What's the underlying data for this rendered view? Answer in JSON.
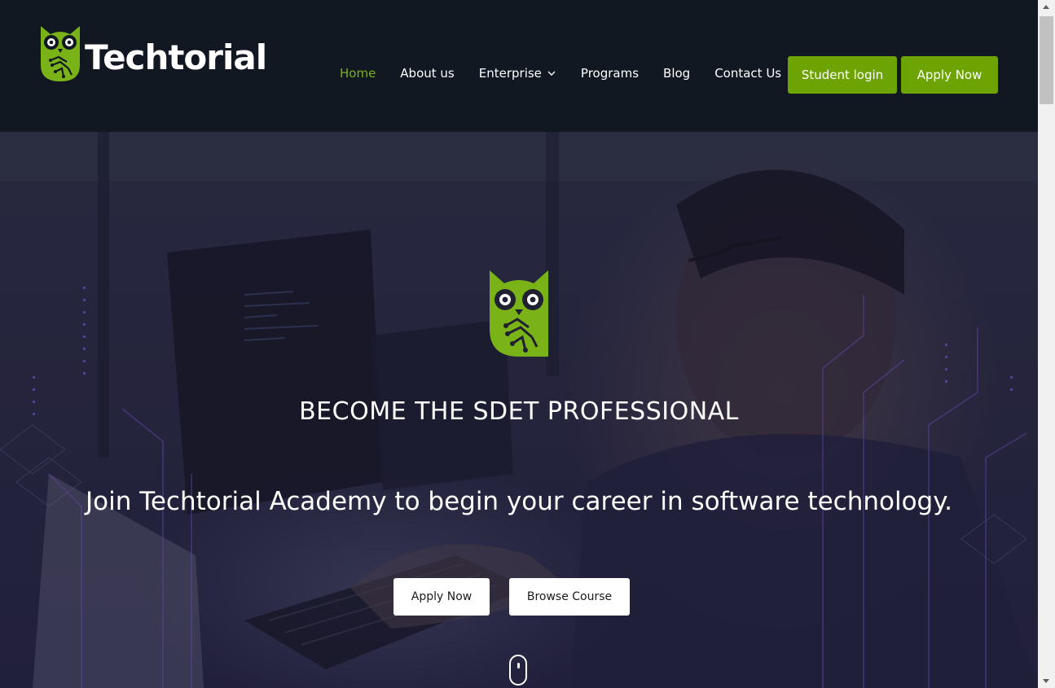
{
  "brand": {
    "name": "Techtorial",
    "accent": "#6da303",
    "logo_icon": "owl-logo-icon"
  },
  "nav": {
    "items": [
      {
        "label": "Home",
        "active": true
      },
      {
        "label": "About us"
      },
      {
        "label": "Enterprise",
        "dropdown": true
      },
      {
        "label": "Programs"
      },
      {
        "label": "Blog"
      },
      {
        "label": "Contact Us"
      }
    ],
    "student_login": "Student login",
    "apply_now": "Apply Now"
  },
  "hero": {
    "title": "BECOME THE SDET PROFESSIONAL",
    "subtitle": "Join Techtorial Academy to begin your career in software technology.",
    "apply_button": "Apply Now",
    "browse_button": "Browse Course",
    "scroll_icon": "mouse-scroll-icon"
  }
}
